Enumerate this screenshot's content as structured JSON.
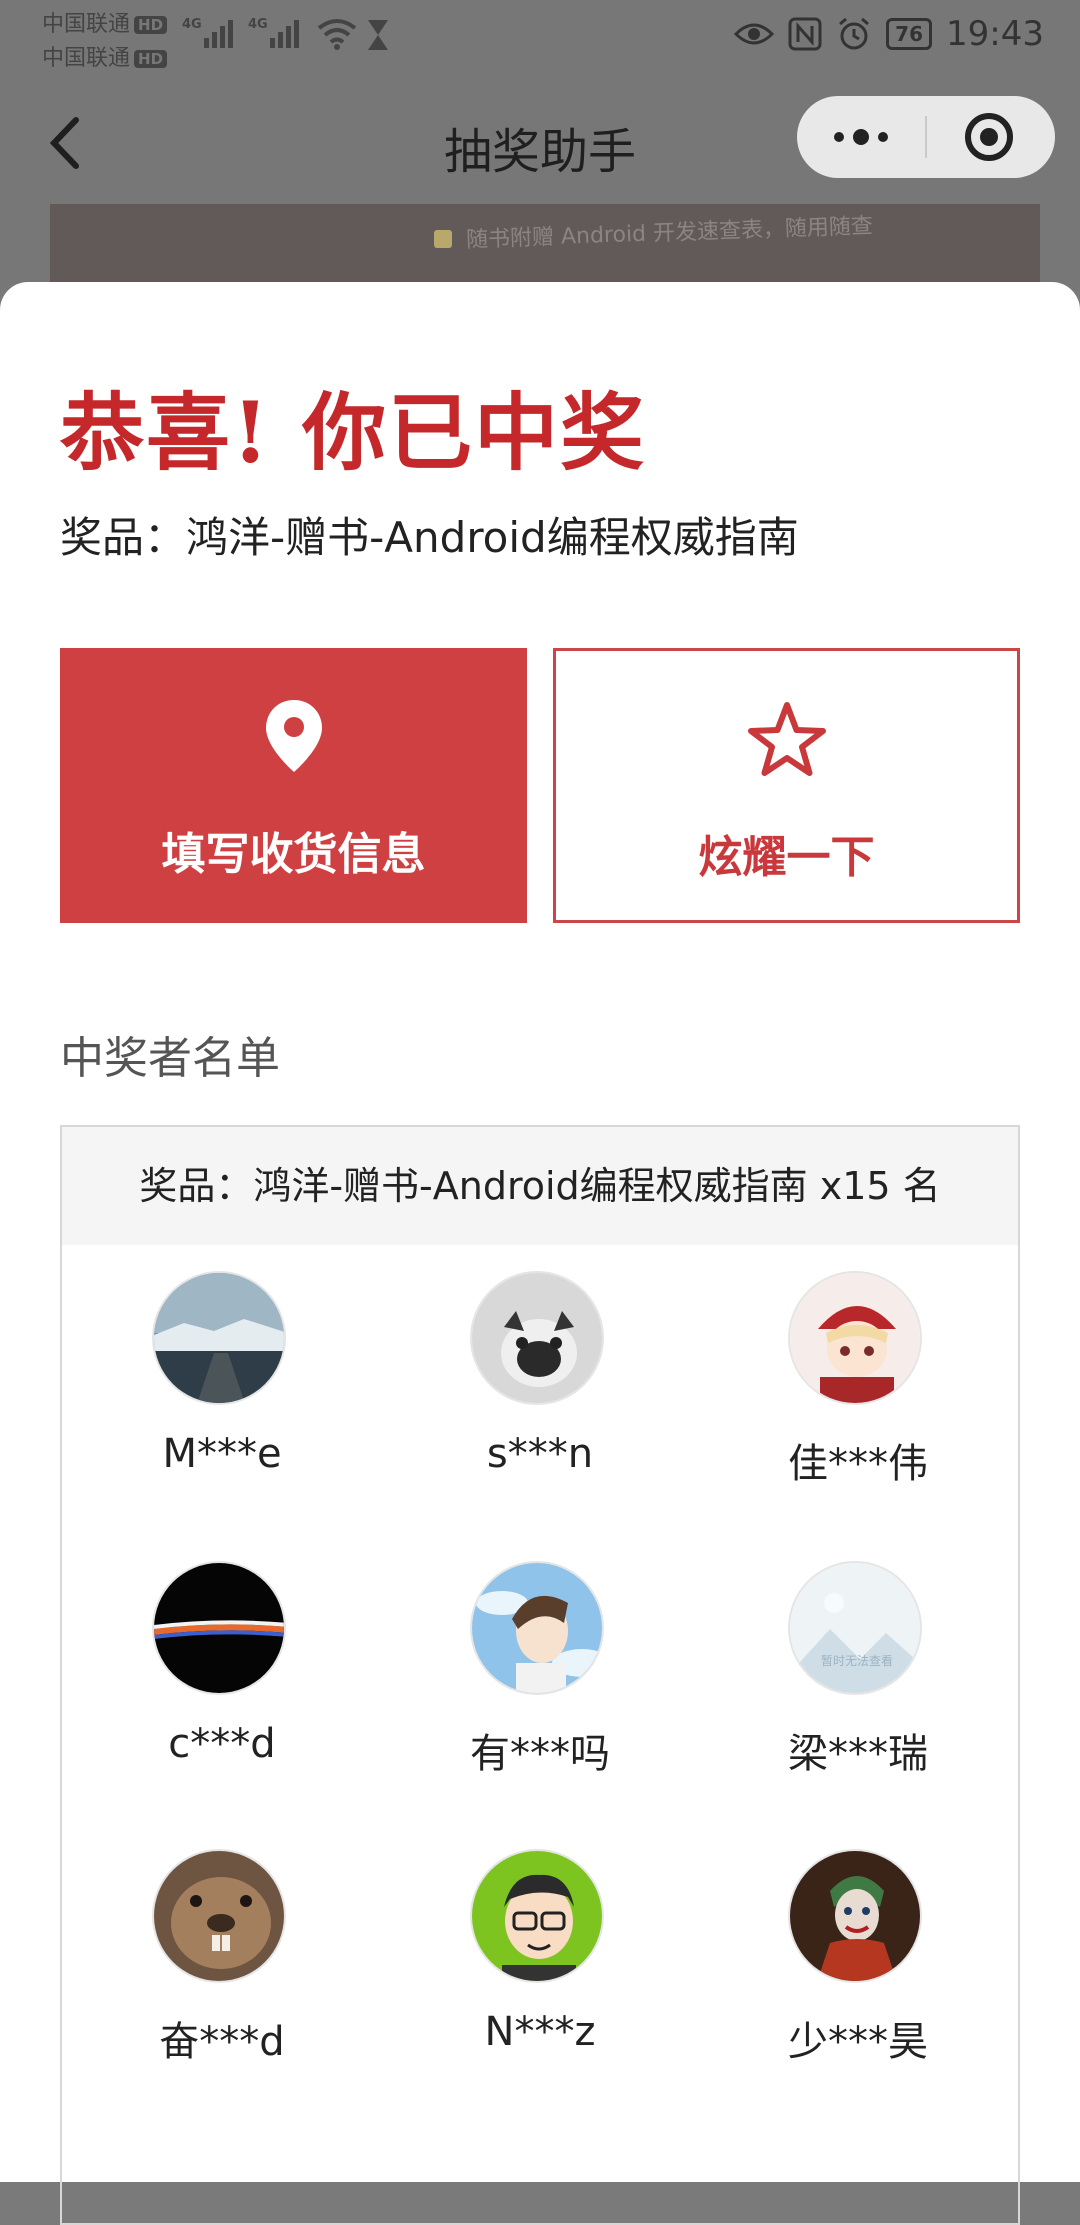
{
  "status_bar": {
    "carrier1": "中国联通",
    "carrier2": "中国联通",
    "hd": "HD",
    "network1": "4G",
    "network2": "4G",
    "battery": "76",
    "time": "19:43"
  },
  "nav": {
    "title": "抽奖助手"
  },
  "peek": {
    "text": "随书附赠 Android 开发速查表，随用随查"
  },
  "result": {
    "headline": "恭喜! 你已中奖",
    "prize_line": "奖品：鸿洋-赠书-Android编程权威指南"
  },
  "actions": {
    "fill_address": "填写收货信息",
    "show_off": "炫耀一下"
  },
  "winners": {
    "heading": "中奖者名单",
    "prize_header": "奖品：鸿洋-赠书-Android编程权威指南 x15 名",
    "list": [
      {
        "name": "M***e",
        "avatar": "snowy-road-avatar"
      },
      {
        "name": "s***n",
        "avatar": "pug-dog-avatar"
      },
      {
        "name": "佳***伟",
        "avatar": "anime-girl-red-hat-avatar"
      },
      {
        "name": "c***d",
        "avatar": "earth-horizon-avatar"
      },
      {
        "name": "有***吗",
        "avatar": "anime-boy-sky-avatar"
      },
      {
        "name": "梁***瑞",
        "avatar": "placeholder-avatar"
      },
      {
        "name": "奋***d",
        "avatar": "beaver-avatar"
      },
      {
        "name": "N***z",
        "avatar": "cartoon-man-glasses-avatar"
      },
      {
        "name": "少***昊",
        "avatar": "joker-avatar"
      }
    ],
    "placeholder_avatar_text": "暂时无法查看"
  },
  "colors": {
    "accent": "#c5282a",
    "button_fill": "#cf4042"
  }
}
